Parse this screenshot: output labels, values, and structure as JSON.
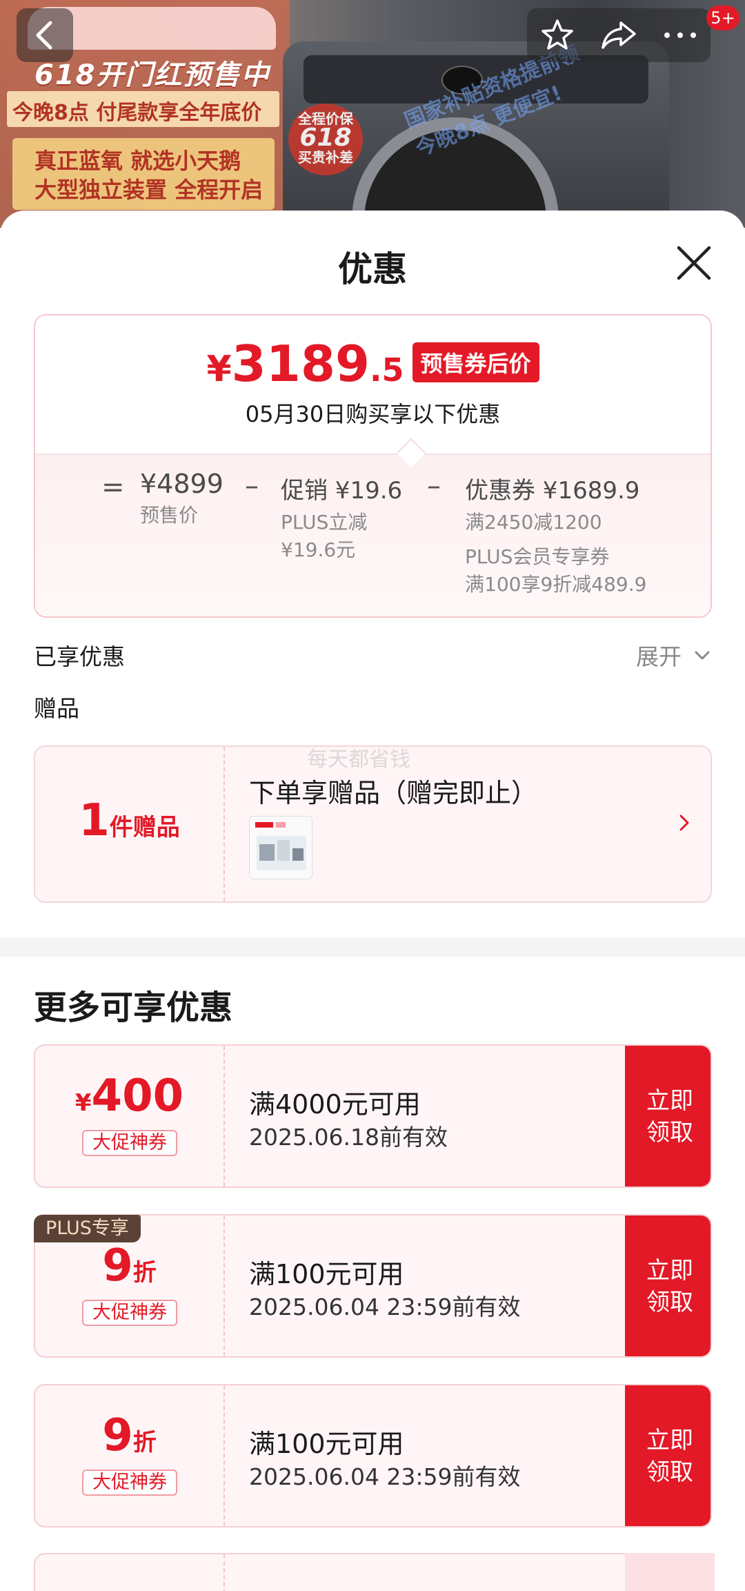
{
  "banner": {
    "headline": "618开门红预售中",
    "strip": "今晚8点 付尾款享全年底价",
    "lines": [
      "真正蓝氧 就选小天鹅",
      "大型独立装置 全程开启"
    ],
    "badge_line1": "全程价保",
    "badge_line2": "618",
    "badge_line3": "买贵补差",
    "overlay": [
      "国家补贴资格提前领",
      "今晚8点 更便宜!"
    ],
    "cart_badge": "5+"
  },
  "sheet": {
    "title": "优惠",
    "price": {
      "currency": "¥",
      "integer": "3189",
      "decimal": ".5",
      "tag": "预售券后价",
      "subtitle": "05月30日购买享以下优惠"
    },
    "breakdown": {
      "equals": "=",
      "minus": "–",
      "presale_value": "¥4899",
      "presale_label": "预售价",
      "promo_label": "促销 ¥19.6",
      "promo_detail1": "PLUS立减",
      "promo_detail2": "¥19.6元",
      "coupon_label": "优惠券 ¥1689.9",
      "coupon_detail1": "满2450减1200",
      "coupon_detail2": "PLUS会员专享券",
      "coupon_detail3": "满100享9折减489.9"
    },
    "enjoyed_label": "已享优惠",
    "expand_label": "展开",
    "gift_section_label": "赠品",
    "gift": {
      "count": "1",
      "unit": "件赠品",
      "title": "下单享赠品（赠完即止）"
    },
    "watermark": "每天都省钱",
    "more_title": "更多可享优惠",
    "coupons": [
      {
        "prefix": "¥",
        "value": "400",
        "suffix": "",
        "type": "大促神券",
        "condition": "满4000元可用",
        "validity": "2025.06.18前有效",
        "button": "立即\n领取"
      },
      {
        "prefix": "",
        "value": "9",
        "suffix": "折",
        "type": "大促神券",
        "condition": "满100元可用",
        "validity": "2025.06.04 23:59前有效",
        "button": "立即\n领取",
        "tag": "PLUS专享"
      },
      {
        "prefix": "",
        "value": "9",
        "suffix": "折",
        "type": "大促神券",
        "condition": "满100元可用",
        "validity": "2025.06.04 23:59前有效",
        "button": "立即\n领取"
      }
    ]
  },
  "colors": {
    "accent": "#e31927",
    "plus_tag": "#5a4236"
  }
}
